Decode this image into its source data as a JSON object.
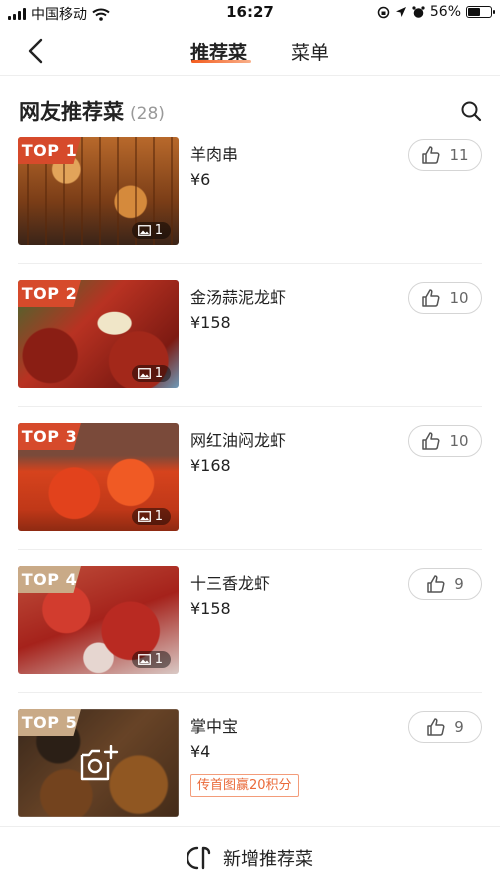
{
  "status_bar": {
    "carrier": "中国移动",
    "time": "16:27",
    "battery": "56%",
    "battery_level": 0.56
  },
  "nav": {
    "tabs": [
      {
        "label": "推荐菜",
        "active": true
      },
      {
        "label": "菜单",
        "active": false
      }
    ]
  },
  "section": {
    "title": "网友推荐菜",
    "count": "(28)"
  },
  "dishes": [
    {
      "rank": "TOP 1",
      "name": "羊肉串",
      "price": "¥6",
      "likes": "11",
      "images": "1",
      "badge_color": "#d64a2b"
    },
    {
      "rank": "TOP 2",
      "name": "金汤蒜泥龙虾",
      "price": "¥158",
      "likes": "10",
      "images": "1",
      "badge_color": "#d64a2b"
    },
    {
      "rank": "TOP 3",
      "name": "网红油闷龙虾",
      "price": "¥168",
      "likes": "10",
      "images": "1",
      "badge_color": "#d64a2b"
    },
    {
      "rank": "TOP 4",
      "name": "十三香龙虾",
      "price": "¥158",
      "likes": "9",
      "images": "1",
      "badge_color": "#c9aa87"
    },
    {
      "rank": "TOP 5",
      "name": "掌中宝",
      "price": "¥4",
      "likes": "9",
      "promo": "传首图赢20积分",
      "badge_color": "#c9aa87"
    }
  ],
  "bottom": {
    "add_label": "新增推荐菜"
  }
}
